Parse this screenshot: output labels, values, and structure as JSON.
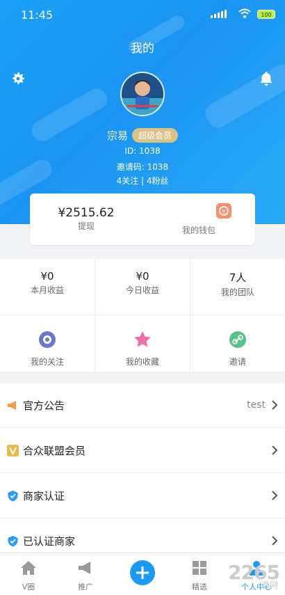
{
  "status": {
    "time": "11:45",
    "battery": "100"
  },
  "header": {
    "title": "我的"
  },
  "profile": {
    "name": "宗易",
    "badge": "超级会员",
    "id_line": "ID: 1038",
    "invite_line": "邀请码: 1038",
    "follow_line": "4关注  |  4粉丝"
  },
  "wallet": {
    "amount": "¥2515.62",
    "withdraw_label": "提现",
    "wallet_label": "我的钱包"
  },
  "stats": [
    {
      "value": "¥0",
      "label": "本月收益"
    },
    {
      "value": "¥0",
      "label": "今日收益"
    },
    {
      "value": "7人",
      "label": "我的团队"
    }
  ],
  "shortcuts": [
    {
      "label": "我的关注",
      "icon": "eye-icon"
    },
    {
      "label": "我的收藏",
      "icon": "star-icon"
    },
    {
      "label": "邀请",
      "icon": "link-icon"
    }
  ],
  "menu": [
    {
      "label": "官方公告",
      "extra": "test",
      "icon": "megaphone-icon"
    },
    {
      "label": "合众联盟会员",
      "extra": "",
      "icon": "v-badge-icon"
    },
    {
      "label": "商家认证",
      "extra": "",
      "icon": "shield-check-icon"
    },
    {
      "label": "已认证商家",
      "extra": "",
      "icon": "shield-check-icon"
    }
  ],
  "tabs": [
    {
      "label": "V圈",
      "icon": "home-icon"
    },
    {
      "label": "推广",
      "icon": "megaphone-icon"
    },
    {
      "label": "",
      "icon": "plus-icon"
    },
    {
      "label": "精选",
      "icon": "grid-icon"
    },
    {
      "label": "个人中心",
      "icon": "person-icon"
    }
  ],
  "watermark": {
    "main": "2265",
    "sub": "游网"
  },
  "colors": {
    "primary": "#1b95f2",
    "vip": "#d9c283",
    "wallet_icon": "#f58f6e"
  }
}
